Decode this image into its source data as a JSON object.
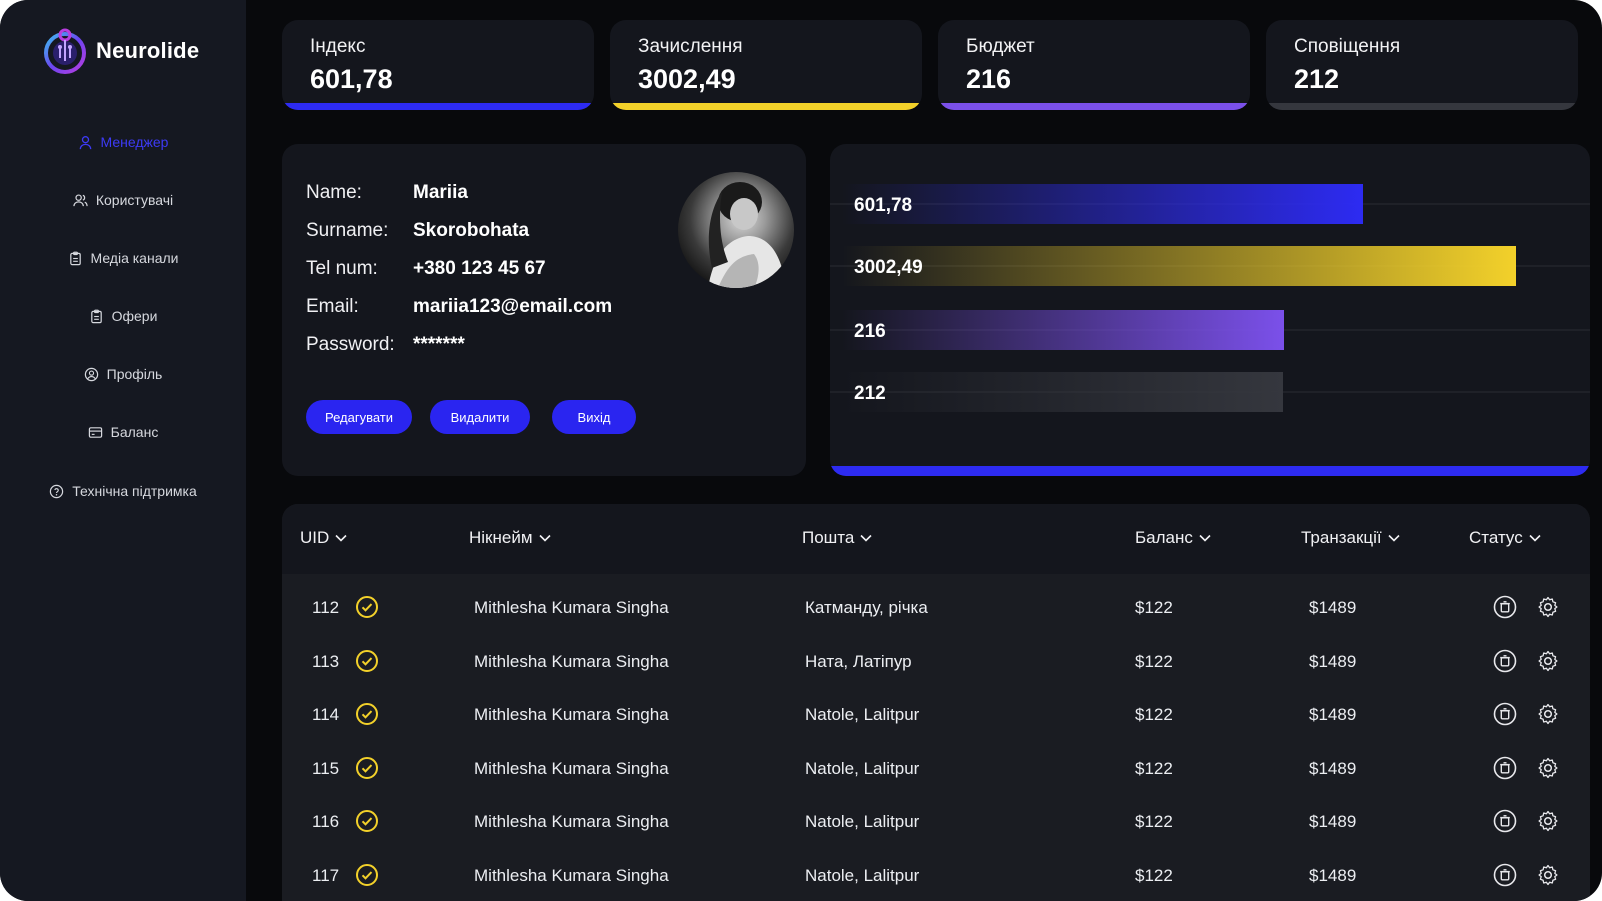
{
  "app": {
    "name": "Neurolide"
  },
  "sidebar": {
    "items": [
      {
        "label": "Менеджер",
        "icon": "user-icon",
        "active": true
      },
      {
        "label": "Користувачі",
        "icon": "users-icon",
        "active": false
      },
      {
        "label": "Медіа канали",
        "icon": "clipboard-icon",
        "active": false
      },
      {
        "label": "Офери",
        "icon": "clipboard-icon",
        "active": false
      },
      {
        "label": "Профіль",
        "icon": "user-circle-icon",
        "active": false
      },
      {
        "label": "Баланс",
        "icon": "card-icon",
        "active": false
      },
      {
        "label": "Технічна підтримка",
        "icon": "help-circle-icon",
        "active": false
      }
    ]
  },
  "stats": [
    {
      "label": "Індекс",
      "value": "601,78",
      "color": "#2d2bf2"
    },
    {
      "label": "Зачислення",
      "value": "3002,49",
      "color": "#f3d12a"
    },
    {
      "label": "Бюджет",
      "value": "216",
      "color": "#7b50ea"
    },
    {
      "label": "Сповіщення",
      "value": "212",
      "color": "#35373e"
    }
  ],
  "profile": {
    "fields": [
      {
        "key": "Name:",
        "value": "Mariia"
      },
      {
        "key": "Surname:",
        "value": "Skorobohata"
      },
      {
        "key": "Tel num:",
        "value": "+380 123 45 67"
      },
      {
        "key": "Email:",
        "value": "mariia123@email.com"
      },
      {
        "key": "Password:",
        "value": "*******"
      }
    ],
    "buttons": {
      "edit": "Редагувати",
      "delete": "Видалити",
      "exit": "Вихід"
    }
  },
  "chart_data": {
    "type": "bar",
    "orientation": "horizontal",
    "categories": [
      "601,78",
      "3002,49",
      "216",
      "212"
    ],
    "values": [
      601.78,
      3002.49,
      216,
      212
    ],
    "colors": [
      "#2d2bf2",
      "#f3d12a",
      "#7b50ea",
      "#35373e"
    ],
    "title": "",
    "xlabel": "",
    "ylabel": "",
    "grid": true
  },
  "table": {
    "headers": [
      "UID",
      "Нікнейм",
      "Пошта",
      "Баланс",
      "Транзакції",
      "Статус"
    ],
    "rows": [
      {
        "uid": "112",
        "nick": "Mithlesha Kumara Singha",
        "mail": "Катманду, річка",
        "balance": "$122",
        "transactions": "$1489"
      },
      {
        "uid": "113",
        "nick": "Mithlesha Kumara Singha",
        "mail": "Ната, Латіпур",
        "balance": "$122",
        "transactions": "$1489"
      },
      {
        "uid": "114",
        "nick": "Mithlesha Kumara Singha",
        "mail": "Natole, Lalitpur",
        "balance": "$122",
        "transactions": "$1489"
      },
      {
        "uid": "115",
        "nick": "Mithlesha Kumara Singha",
        "mail": "Natole, Lalitpur",
        "balance": "$122",
        "transactions": "$1489"
      },
      {
        "uid": "116",
        "nick": "Mithlesha Kumara Singha",
        "mail": "Natole, Lalitpur",
        "balance": "$122",
        "transactions": "$1489"
      },
      {
        "uid": "117",
        "nick": "Mithlesha Kumara Singha",
        "mail": "Natole, Lalitpur",
        "balance": "$122",
        "transactions": "$1489"
      }
    ]
  },
  "colors": {
    "accent": "#2d2bf2",
    "status_check": "#f3d12a"
  }
}
